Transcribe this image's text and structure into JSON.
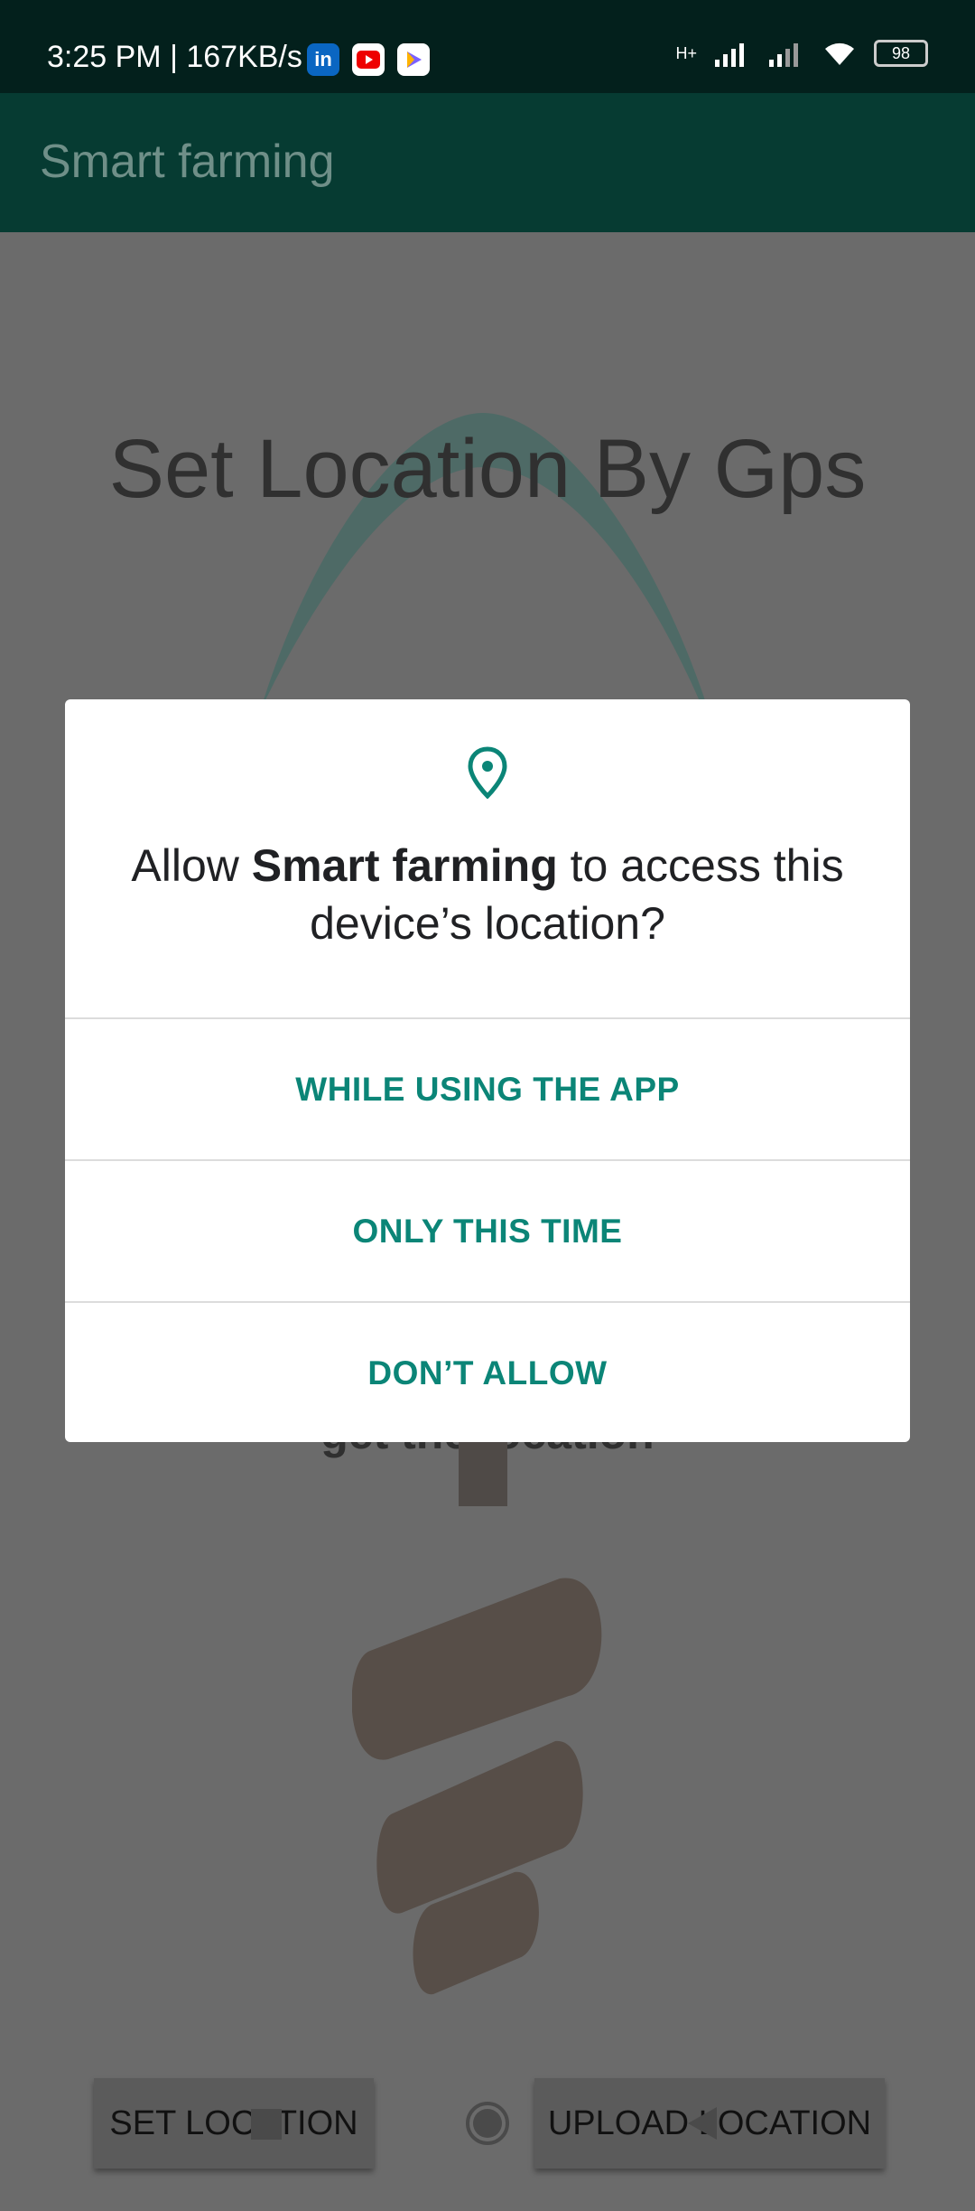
{
  "status_bar": {
    "time_and_speed": "3:25 PM | 167KB/s",
    "network_label": "H+",
    "battery": "98"
  },
  "app_bar": {
    "title": "Smart farming"
  },
  "main": {
    "heading": "Set Location By Gps",
    "hint": "get the location",
    "set_location_button": "SET LOCATION",
    "upload_location_button": "UPLOAD LOCATION"
  },
  "dialog": {
    "title_prefix": "Allow ",
    "title_app": "Smart farming",
    "title_suffix": " to access this device’s location?",
    "options": [
      "WHILE USING THE APP",
      "ONLY THIS TIME",
      "DON’T ALLOW"
    ]
  },
  "colors": {
    "accent": "#0b8577",
    "app_bar": "#063b32",
    "scrim": "#6b6b6b"
  }
}
